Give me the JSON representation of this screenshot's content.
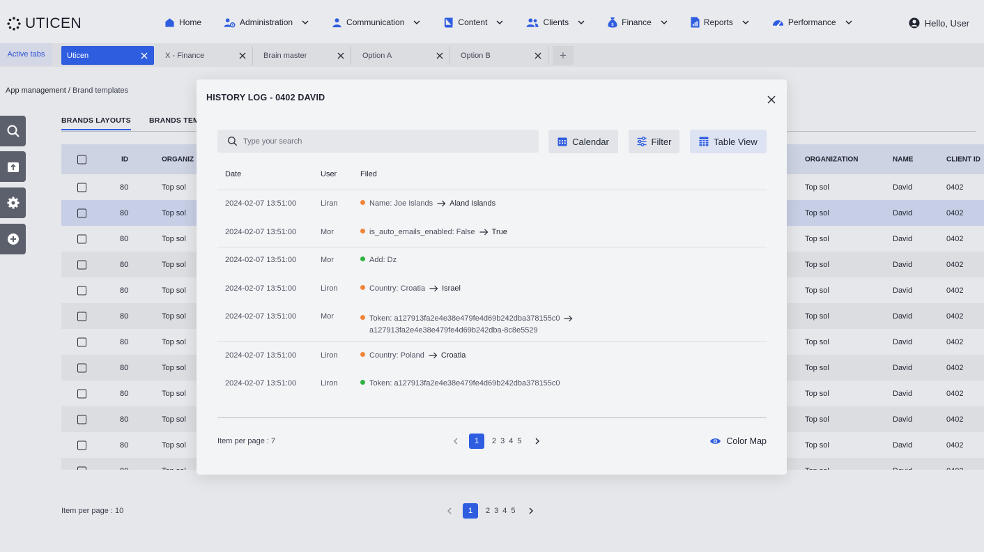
{
  "brand": {
    "name": "UTICEN"
  },
  "nav": {
    "items": [
      {
        "label": "Home",
        "icon": "home-icon"
      },
      {
        "label": "Administration",
        "icon": "admin-users-icon"
      },
      {
        "label": "Communication",
        "icon": "person-icon"
      },
      {
        "label": "Content",
        "icon": "book-icon"
      },
      {
        "label": "Clients",
        "icon": "clients-icon"
      },
      {
        "label": "Finance",
        "icon": "money-bag-icon"
      },
      {
        "label": "Reports",
        "icon": "report-icon"
      },
      {
        "label": "Performance",
        "icon": "gauge-icon"
      }
    ],
    "greeting": "Hello, User"
  },
  "tabs": {
    "label": "Active tabs",
    "items": [
      {
        "label": "Uticen",
        "active": true
      },
      {
        "label": "X - Finance"
      },
      {
        "label": "Brain master"
      },
      {
        "label": "Option A"
      },
      {
        "label": "Option B"
      }
    ],
    "add": "+"
  },
  "breadcrumb": {
    "parent": "App management",
    "separator": " / ",
    "current": "Brand templates"
  },
  "bg": {
    "tabs": [
      "BRANDS LAYOUTS",
      "BRANDS TEMI"
    ],
    "columns": [
      "ID",
      "ORGANIZ",
      "ORGANIZATION",
      "NAME",
      "CLIENT ID"
    ],
    "row": {
      "id": "80",
      "org": "Top sol",
      "org2": "Top sol",
      "name": "David",
      "client": "0402"
    },
    "per_page": "Item per page : 10",
    "pages": [
      "1",
      "2",
      "3",
      "4",
      "5"
    ]
  },
  "modal": {
    "title": "HISTORY LOG - 0402 DAVID",
    "search_placeholder": "Type your search",
    "buttons": {
      "calendar": "Calendar",
      "filter": "Filter",
      "table_view": "Table View"
    },
    "columns": {
      "date": "Date",
      "user": "User",
      "filed": "Filed"
    },
    "rows": [
      {
        "date": "2024-02-07 13:51:00",
        "user": "Liran",
        "dot": "#f0863a",
        "field": "Name: Joe Islands",
        "new": "Aland Islands"
      },
      {
        "date": "2024-02-07 13:51:00",
        "user": "Mor",
        "dot": "#f0863a",
        "field": "is_auto_emails_enabled: False",
        "new": "True"
      },
      {
        "date": "2024-02-07 13:51:00",
        "user": "Mor",
        "dot": "#2fb344",
        "field": "Add: Dz",
        "new": ""
      },
      {
        "date": "2024-02-07 13:51:00",
        "user": "Liron",
        "dot": "#f0863a",
        "field": "Country: Croatia",
        "new": "Israel"
      },
      {
        "date": "2024-02-07 13:51:00",
        "user": "Mor",
        "dot": "#f0863a",
        "field": "Token: a127913fa2e4e38e479fe4d69b242dba378155c0",
        "new": "a127913fa2e4e38e479fe4d69b242dba-8c8e5529"
      },
      {
        "date": "2024-02-07 13:51:00",
        "user": "Liron",
        "dot": "#f0863a",
        "field": "Country: Poland",
        "new": "Croatia"
      },
      {
        "date": "2024-02-07 13:51:00",
        "user": "Liron",
        "dot": "#2fb344",
        "field": "Token: a127913fa2e4e38e479fe4d69b242dba378155c0",
        "new": ""
      }
    ],
    "per_page": "Item per page : 7",
    "pages": [
      "1",
      "2",
      "3",
      "4",
      "5"
    ],
    "color_map": "Color Map"
  },
  "colors": {
    "accent": "#2f5de0",
    "orange": "#f0863a",
    "green": "#2fb344"
  }
}
